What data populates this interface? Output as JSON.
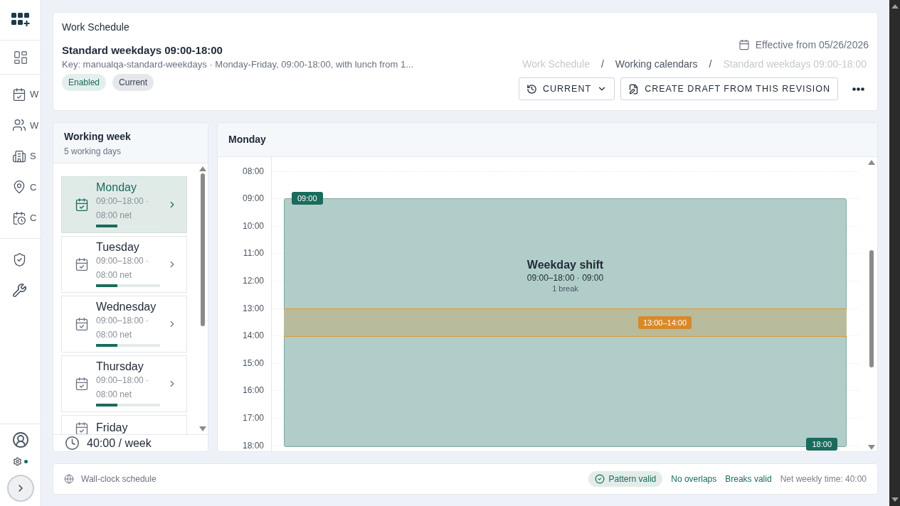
{
  "sidebar": {
    "items": [
      {
        "label": "W",
        "selected": false
      },
      {
        "label": "W",
        "selected": false
      },
      {
        "label": "S",
        "selected": false
      },
      {
        "label": "C",
        "selected": false
      },
      {
        "label": "C",
        "selected": false
      }
    ]
  },
  "header": {
    "section": "Work Schedule",
    "title": "Standard weekdays 09:00-18:00",
    "description": "Key: manualqa-standard-weekdays · Monday-Friday, 09:00-18:00, with lunch from 1...",
    "badges": [
      {
        "label": "Enabled",
        "kind": "success"
      },
      {
        "label": "Current",
        "kind": "neutral"
      }
    ],
    "effective": "Effective from 05/26/2026",
    "breadcrumbs": [
      {
        "label": "Work Schedule",
        "disabled": true
      },
      {
        "label": "Working calendars",
        "disabled": false
      },
      {
        "label": "Standard weekdays 09:00-18:00",
        "disabled": true
      }
    ],
    "separators": [
      "/",
      "/"
    ],
    "version_button": "CURRENT",
    "draft_button": "CREATE DRAFT FROM THIS REVISION"
  },
  "week": {
    "title": "Working week",
    "subtitle": "5 working days",
    "days": [
      {
        "name": "Monday",
        "range": "09:00–18:00 ·",
        "net": "08:00 net",
        "level": 0.33,
        "selected": true
      },
      {
        "name": "Tuesday",
        "range": "09:00–18:00 ·",
        "net": "08:00 net",
        "level": 0.33,
        "selected": false
      },
      {
        "name": "Wednesday",
        "range": "09:00–18:00 ·",
        "net": "08:00 net",
        "level": 0.33,
        "selected": false
      },
      {
        "name": "Thursday",
        "range": "09:00–18:00 ·",
        "net": "08:00 net",
        "level": 0.33,
        "selected": false
      },
      {
        "name": "Friday",
        "selected": false
      }
    ],
    "total": "40:00 / week"
  },
  "day": {
    "title": "Monday",
    "hours": [
      "08:00",
      "09:00",
      "10:00",
      "11:00",
      "12:00",
      "13:00",
      "14:00",
      "15:00",
      "16:00",
      "17:00",
      "18:00"
    ],
    "shift": {
      "title": "Weekday shift",
      "range": "09:00–18:00 · 09:00",
      "breaks": "1 break",
      "start": "09:00",
      "end": "18:00"
    },
    "break": {
      "label": "13:00–14:00"
    }
  },
  "footer": {
    "mode": "Wall-clock schedule",
    "checks": [
      {
        "label": "Pattern valid",
        "kind": "pill"
      },
      {
        "label": "No overlaps",
        "kind": "link"
      },
      {
        "label": "Breaks valid",
        "kind": "link"
      },
      {
        "label": "Net weekly time: 40:00",
        "kind": "muted"
      }
    ]
  }
}
